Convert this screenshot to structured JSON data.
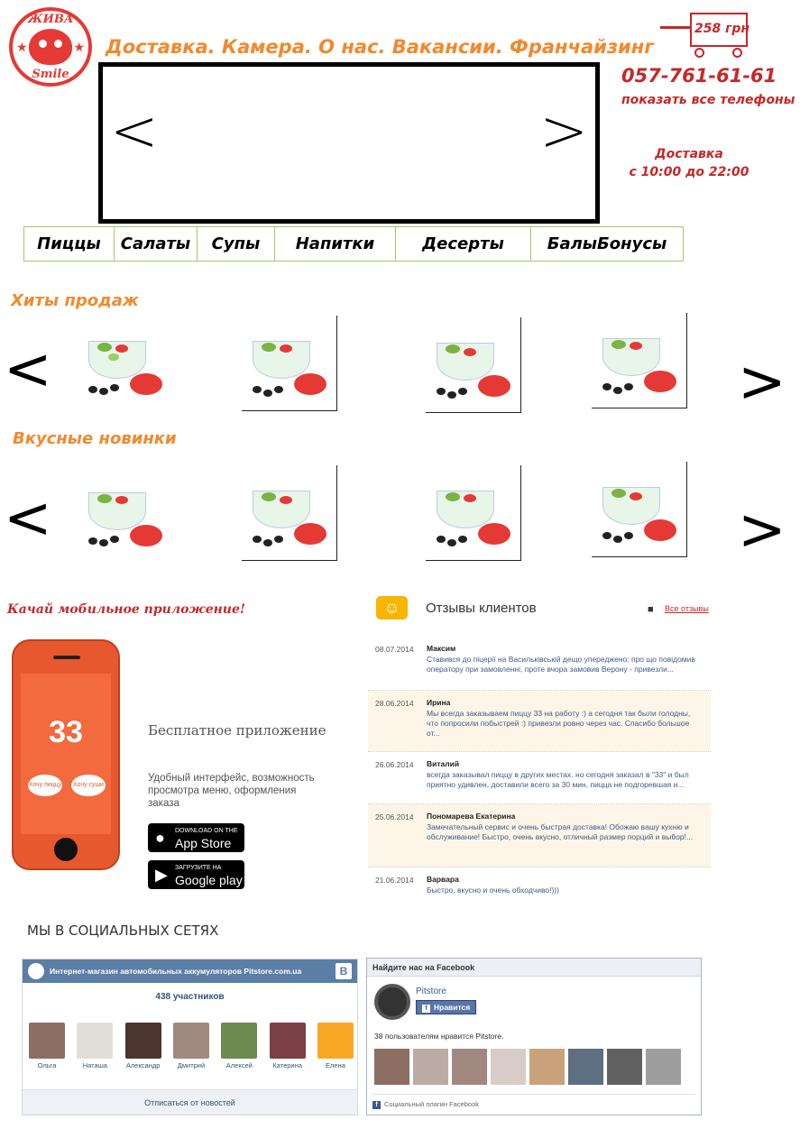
{
  "logo": {
    "top_text": "ЖИВА",
    "bottom_text": "Smile"
  },
  "topnav": {
    "text": "Доставка. Камера. О нас. Вакансии. Франчайзинг"
  },
  "banner": {
    "prev": "<",
    "next": ">"
  },
  "cart": {
    "price": "258 грн"
  },
  "contact": {
    "phone": "057-761-61-61",
    "all_phones": "показать все телефоны",
    "delivery_title": "Доставка",
    "delivery_hours": "с 10:00 до 22:00"
  },
  "categories": [
    "Пиццы",
    "Салаты",
    "Супы",
    "Напитки",
    "Десерты",
    "БалыБонусы"
  ],
  "sections": {
    "hits": {
      "title": "Хиты продаж",
      "prev": "<",
      "next": ">"
    },
    "new": {
      "title": "Вкусные новинки",
      "prev": "<",
      "next": ">"
    }
  },
  "app": {
    "title": "Качай мобильное приложение!",
    "screen_number": "33",
    "bubble_left": "Хочу пиццу",
    "bubble_right": "Хочу суши",
    "free": "Бесплатное приложение",
    "desc": "Удобный интерфейс, возможность просмотра меню, оформления заказа",
    "appstore_small": "Download on the",
    "appstore_big": "App Store",
    "google_small": "Загрузите на",
    "google_big": "Google play"
  },
  "reviews": {
    "title": "Отзывы клиентов",
    "all_link": "Все отзывы",
    "items": [
      {
        "date": "08.07.2014",
        "name": "Максим",
        "text": "Ставився до піцерії на Васильківській дещо упереджено: про що повідомив оператору при замовленні, проте вчора замовив Верону - привезли..."
      },
      {
        "date": "28.06.2014",
        "name": "Ирина",
        "text": "Мы всегда заказываем пиццу 33 на работу :) а сегодня так были голодны, что попросили побыстрей :) привезли ровно через час. Спасибо большое от..."
      },
      {
        "date": "26.06.2014",
        "name": "Виталий",
        "text": "всегда заказывал пиццу в других местах. но сегодня заказал в \"33\" и был приятно удивлен, доставили всего за 30 мин, пицца не подгоревшая и..."
      },
      {
        "date": "25.06.2014",
        "name": "Пономарева Екатерина",
        "text": "Замечательный сервис и очень быстрая доставка! Обожаю вашу кухню и обслуживание! Быстро, очень вкусно, отличный размер порций и выбор!..."
      },
      {
        "date": "21.06.2014",
        "name": "Варвара",
        "text": "Быстро, вкусно и очень обходчиво!)))"
      }
    ]
  },
  "social": {
    "title": "МЫ В СОЦИАЛЬНЫХ СЕТЯХ",
    "vk": {
      "group_name": "Интернет-магазин автомобильных аккумуляторов Pitstore.com.ua",
      "logo_letter": "В",
      "members_count": "438 участников",
      "members": [
        "Ольга",
        "Наташа",
        "Александр",
        "Дмитрий",
        "Алексей",
        "Катерина",
        "Елена"
      ],
      "footer": "Отписаться от новостей"
    },
    "fb": {
      "header": "Найдите нас на Facebook",
      "page_name": "Pitstore",
      "like": "Нравится",
      "count_text": "38 пользователям нравится Pitstore.",
      "footer": "Социальный плагин Facebook",
      "f_letter": "f"
    }
  },
  "colors": {
    "accent_orange": "#f08a2e",
    "accent_red": "#c62828",
    "menu_border": "#9ccc65",
    "vk_blue": "#5b7ea6",
    "fb_blue": "#3b5998"
  }
}
